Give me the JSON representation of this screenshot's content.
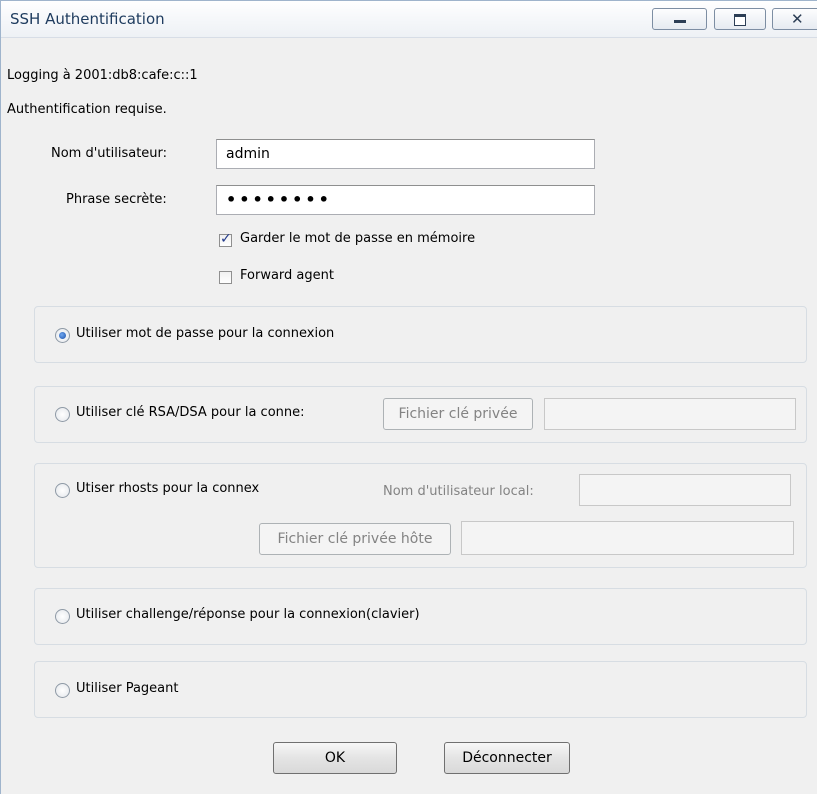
{
  "window": {
    "title": "SSH Authentification",
    "controls": {
      "minimize": "",
      "maximize": "",
      "close": "✕"
    }
  },
  "info": {
    "logging": "Logging à 2001:db8:cafe:c::1",
    "auth_required": "Authentification requise."
  },
  "form": {
    "username_label": "Nom d'utilisateur:",
    "username_value": "admin",
    "passphrase_label": "Phrase secrète:",
    "passphrase_value": "••••••••",
    "remember_password": {
      "label": "Garder le mot de passe en mémoire",
      "checked": true
    },
    "forward_agent": {
      "label": "Forward agent",
      "checked": false
    }
  },
  "methods": {
    "password": {
      "label": "Utiliser mot de passe pour la connexion",
      "selected": true
    },
    "rsa": {
      "label": "Utiliser clé RSA/DSA pour la conne:",
      "selected": false,
      "private_key_button": "Fichier clé privée",
      "private_key_value": ""
    },
    "rhosts": {
      "label": "Utiser rhosts pour la connex",
      "selected": false,
      "local_user_label": "Nom d'utilisateur local:",
      "local_user_value": "",
      "host_key_button": "Fichier clé privée hôte",
      "host_key_value": ""
    },
    "challenge": {
      "label": "Utiliser challenge/réponse pour la connexion(clavier)",
      "selected": false
    },
    "pageant": {
      "label": "Utiliser Pageant",
      "selected": false
    }
  },
  "buttons": {
    "ok": "OK",
    "disconnect": "Déconnecter"
  }
}
